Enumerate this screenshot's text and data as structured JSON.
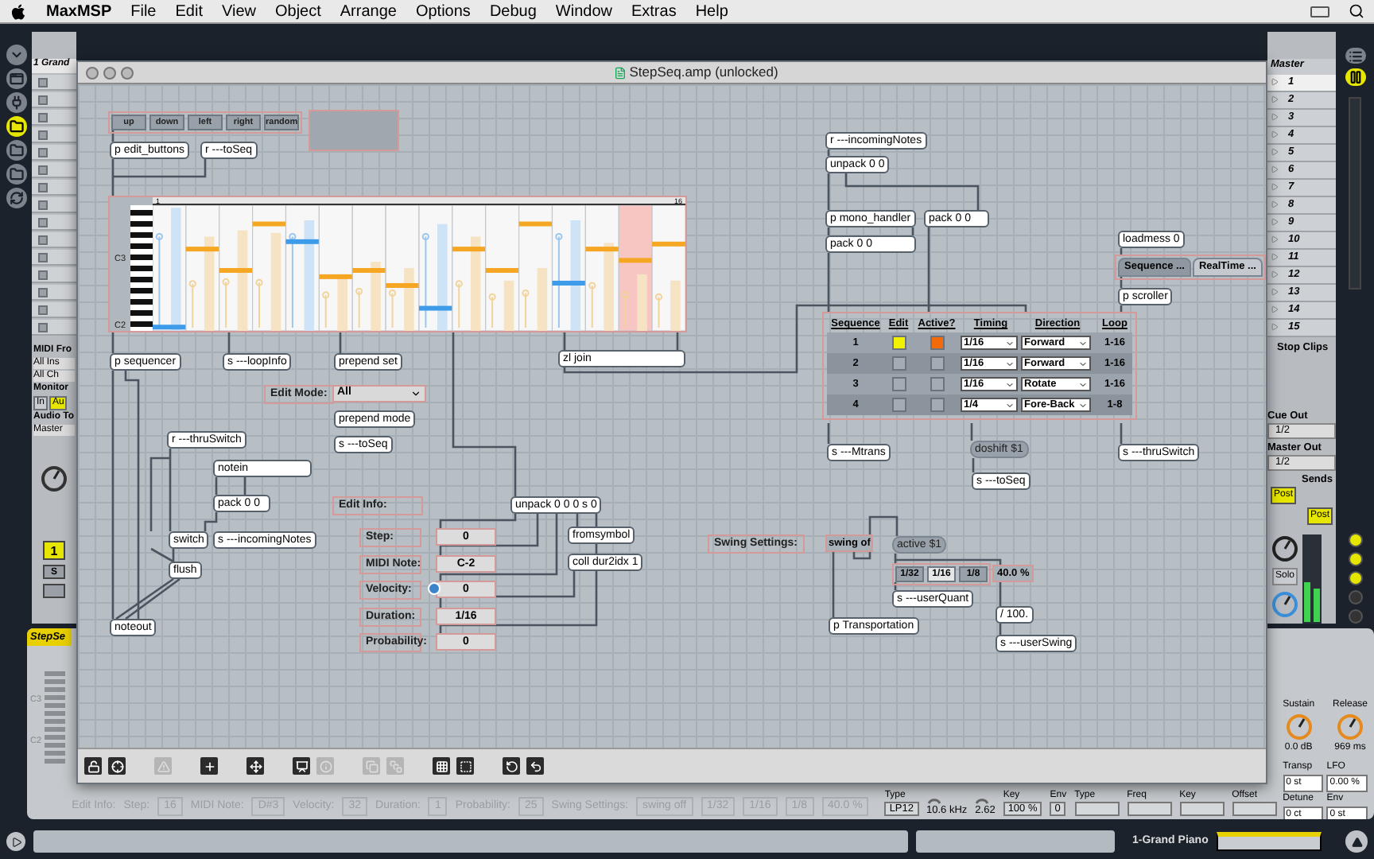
{
  "menu_bar": {
    "app": "MaxMSP",
    "items": [
      "File",
      "Edit",
      "View",
      "Object",
      "Arrange",
      "Options",
      "Debug",
      "Window",
      "Extras",
      "Help"
    ]
  },
  "live": {
    "sidebar_buttons": [
      {
        "kind": "triangle",
        "selected": false
      },
      {
        "kind": "window",
        "selected": false
      },
      {
        "kind": "plug",
        "selected": false
      },
      {
        "kind": "folder",
        "selected": true
      },
      {
        "kind": "folder",
        "selected": false
      },
      {
        "kind": "folder",
        "selected": false
      },
      {
        "kind": "refresh",
        "selected": false
      }
    ],
    "view_buttons": [
      {
        "kind": "list",
        "selected": false
      },
      {
        "kind": "pause",
        "selected": true
      }
    ],
    "toggle_buttons": [
      {
        "on": true
      },
      {
        "on": true
      },
      {
        "on": true
      },
      {
        "on": false
      },
      {
        "on": false
      }
    ],
    "track": {
      "name": "1 Grand",
      "midi_from": "MIDI Fro",
      "input": "All Ins",
      "channel": "All Ch",
      "monitor": "Monitor",
      "monitor_options": [
        {
          "label": "In",
          "selected": false
        },
        {
          "label": "Au",
          "selected": true
        }
      ],
      "audio_to": "Audio To",
      "output": "Master",
      "number": "1",
      "active": true,
      "solo": "S"
    },
    "master": {
      "title": "Master",
      "scenes": [
        {
          "label": "1",
          "selected": true
        },
        {
          "label": "2",
          "selected": false
        },
        {
          "label": "3",
          "selected": false
        },
        {
          "label": "4",
          "selected": false
        },
        {
          "label": "5",
          "selected": false
        },
        {
          "label": "6",
          "selected": false
        },
        {
          "label": "7",
          "selected": false
        },
        {
          "label": "8",
          "selected": false
        },
        {
          "label": "9",
          "selected": false
        },
        {
          "label": "10",
          "selected": false
        },
        {
          "label": "11",
          "selected": false
        },
        {
          "label": "12",
          "selected": false
        },
        {
          "label": "13",
          "selected": false
        },
        {
          "label": "14",
          "selected": false
        },
        {
          "label": "15",
          "selected": false
        }
      ],
      "stop_clips": "Stop Clips",
      "cue_out_label": "Cue Out",
      "cue_out": "1/2",
      "master_out_label": "Master Out",
      "master_out": "1/2",
      "sends": "Sends",
      "post": [
        {
          "label": "Post",
          "on": true
        },
        {
          "label": "Post",
          "on": true
        }
      ],
      "solo": "Solo"
    },
    "device": {
      "title": "StepSe",
      "piano_labels": [
        "C3",
        "C2"
      ],
      "info_strip": [
        {
          "kind": "label",
          "text": "Edit Info:"
        },
        {
          "kind": "label",
          "text": "Step:"
        },
        {
          "kind": "value",
          "text": "16"
        },
        {
          "kind": "label",
          "text": "MIDI Note:"
        },
        {
          "kind": "value",
          "text": "D#3"
        },
        {
          "kind": "label",
          "text": "Velocity:"
        },
        {
          "kind": "value",
          "text": "32"
        },
        {
          "kind": "label",
          "text": "Duration:"
        },
        {
          "kind": "value",
          "text": "1"
        },
        {
          "kind": "label",
          "text": "Probability:"
        },
        {
          "kind": "value",
          "text": "25"
        },
        {
          "kind": "label",
          "text": "Swing Settings:"
        },
        {
          "kind": "value",
          "text": "swing off"
        },
        {
          "kind": "value",
          "text": "1/32"
        },
        {
          "kind": "value",
          "text": "1/16"
        },
        {
          "kind": "value",
          "text": "1/8"
        },
        {
          "kind": "value",
          "text": "40.0 %"
        }
      ],
      "filter": [
        {
          "kind": "menu",
          "label": "Type",
          "value": "LP12"
        },
        {
          "kind": "knob",
          "value": "10.6 kHz"
        },
        {
          "kind": "knob",
          "value": "2.62"
        },
        {
          "kind": "field",
          "label": "Key",
          "value": "100 %"
        },
        {
          "kind": "field",
          "label": "Env",
          "value": "0"
        },
        {
          "kind": "menu",
          "label": "Type"
        },
        {
          "kind": "field",
          "label": "Freq"
        },
        {
          "kind": "field",
          "label": "Key"
        },
        {
          "kind": "field",
          "label": "Offset"
        }
      ],
      "envelope": [
        {
          "label": "Sustain",
          "value": "0.0 dB"
        },
        {
          "label": "Release",
          "value": "969 ms"
        }
      ],
      "pitch": [
        {
          "label": "Transp",
          "value": "0 st"
        },
        {
          "label": "LFO",
          "value": "0.00 %"
        },
        {
          "label": "Detune",
          "value": "0 ct"
        },
        {
          "label": "Env",
          "value": "0 st"
        }
      ]
    },
    "bottom_bar": {
      "track": "1-Grand Piano"
    }
  },
  "patcher": {
    "title": "StepSeq.amp (unlocked)",
    "edit_buttons": [
      "up",
      "down",
      "left",
      "right",
      "random"
    ],
    "objects": [
      {
        "kind": "object",
        "text": "p edit_buttons"
      },
      {
        "kind": "object",
        "text": "r ---toSeq"
      },
      {
        "kind": "object",
        "text": "p sequencer"
      },
      {
        "kind": "object",
        "text": "s ---loopInfo"
      },
      {
        "kind": "object",
        "text": "prepend set"
      },
      {
        "kind": "object",
        "text": "zl join"
      },
      {
        "kind": "object",
        "text": "prepend mode"
      },
      {
        "kind": "object",
        "text": "s ---toSeq"
      },
      {
        "kind": "object",
        "text": "r ---thruSwitch"
      },
      {
        "kind": "object",
        "text": "notein"
      },
      {
        "kind": "object",
        "text": "pack 0 0"
      },
      {
        "kind": "object",
        "text": "switch"
      },
      {
        "kind": "object",
        "text": "s ---incomingNotes"
      },
      {
        "kind": "object",
        "text": "flush"
      },
      {
        "kind": "object",
        "text": "noteout"
      },
      {
        "kind": "object",
        "text": "unpack 0 0 0 s 0"
      },
      {
        "kind": "object",
        "text": "fromsymbol"
      },
      {
        "kind": "object",
        "text": "coll dur2idx 1"
      },
      {
        "kind": "object",
        "text": "r ---incomingNotes"
      },
      {
        "kind": "object",
        "text": "unpack 0 0"
      },
      {
        "kind": "object",
        "text": "p mono_handler"
      },
      {
        "kind": "object",
        "text": "pack 0 0"
      },
      {
        "kind": "object",
        "text": "pack 0 0"
      },
      {
        "kind": "object",
        "text": "loadmess 0"
      },
      {
        "kind": "object",
        "text": "p scroller"
      },
      {
        "kind": "object",
        "text": "s ---Mtrans"
      },
      {
        "kind": "message",
        "text": "doshift $1"
      },
      {
        "kind": "object",
        "text": "s ---toSeq"
      },
      {
        "kind": "object",
        "text": "s ---thruSwitch"
      },
      {
        "kind": "message",
        "text": "active $1"
      },
      {
        "kind": "object",
        "text": "s ---userQuant"
      },
      {
        "kind": "object",
        "text": "p Transportation"
      },
      {
        "kind": "object",
        "text": "/ 100."
      },
      {
        "kind": "object",
        "text": "s ---userSwing"
      }
    ],
    "sequencer": {
      "labels": [
        "C3",
        "C2"
      ],
      "start": "1",
      "end": "16"
    },
    "edit_mode": {
      "label": "Edit Mode:",
      "value": "All"
    },
    "edit_info": "Edit Info:",
    "edit_fields": [
      {
        "label": "Step:",
        "value": "0"
      },
      {
        "label": "MIDI Note:",
        "value": "C-2"
      },
      {
        "label": "Velocity:",
        "value": "0"
      },
      {
        "label": "Duration:",
        "value": "1/16"
      },
      {
        "label": "Probability:",
        "value": "0"
      }
    ],
    "view_tabs": [
      {
        "label": "Sequence ...",
        "selected": true
      },
      {
        "label": "RealTime ...",
        "selected": false
      }
    ],
    "sequence_table": {
      "columns": [
        "Sequence",
        "Edit",
        "Active?",
        "Timing",
        "Direction",
        "Loop"
      ],
      "rows": [
        {
          "number": "1",
          "edit": true,
          "active": true,
          "timing": "1/16",
          "direction": "Forward",
          "loop": "1-16"
        },
        {
          "number": "2",
          "edit": false,
          "active": false,
          "timing": "1/16",
          "direction": "Forward",
          "loop": "1-16"
        },
        {
          "number": "3",
          "edit": false,
          "active": false,
          "timing": "1/16",
          "direction": "Rotate",
          "loop": "1-16"
        },
        {
          "number": "4",
          "edit": false,
          "active": false,
          "timing": "1/4",
          "direction": "Fore-Back",
          "loop": "1-8"
        }
      ]
    },
    "swing": {
      "label": "Swing Settings:",
      "toggle": "swing of",
      "quantize": [
        {
          "label": "1/32",
          "selected": false
        },
        {
          "label": "1/16",
          "selected": true
        },
        {
          "label": "1/8",
          "selected": false
        }
      ],
      "amount": "40.0 %"
    },
    "toolbar": [
      {
        "kind": "lock",
        "disabled": false
      },
      {
        "kind": "target",
        "disabled": false
      },
      {
        "kind": "warning",
        "disabled": true
      },
      {
        "kind": "plus",
        "disabled": false
      },
      {
        "kind": "move",
        "disabled": false
      },
      {
        "kind": "presentation",
        "disabled": false
      },
      {
        "kind": "info",
        "disabled": true
      },
      {
        "kind": "front",
        "disabled": true
      },
      {
        "kind": "back",
        "disabled": true
      },
      {
        "kind": "grid",
        "disabled": false
      },
      {
        "kind": "snap",
        "disabled": false
      },
      {
        "kind": "refresh",
        "disabled": false
      },
      {
        "kind": "undo",
        "disabled": false
      }
    ]
  }
}
